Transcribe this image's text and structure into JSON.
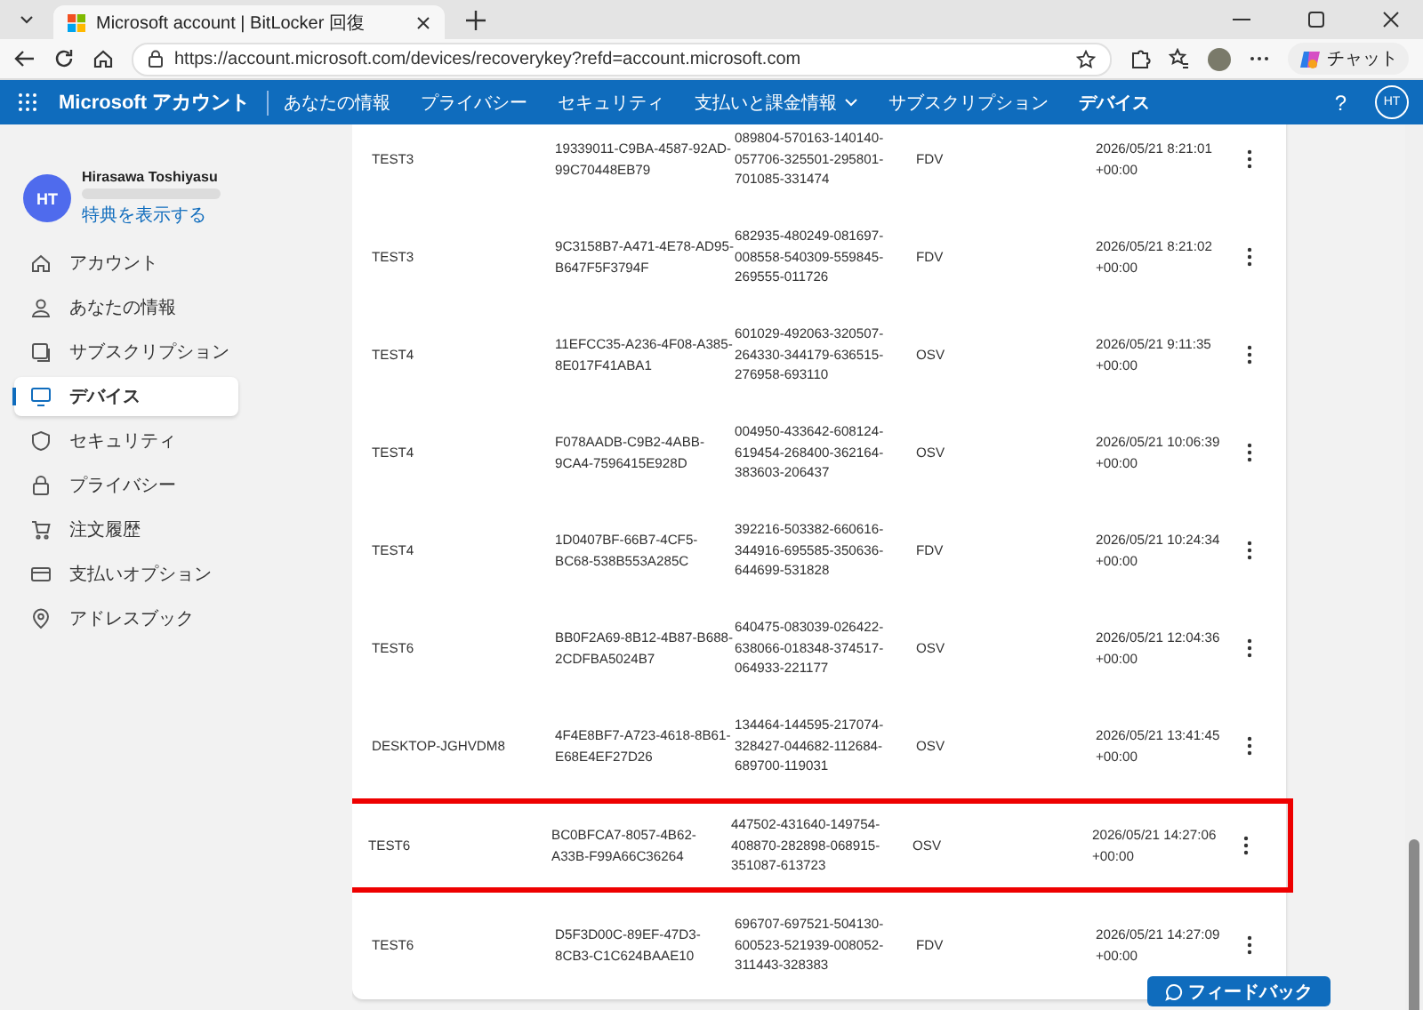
{
  "browser": {
    "tab_title": "Microsoft account | BitLocker 回復",
    "url": "https://account.microsoft.com/devices/recoverykey?refd=account.microsoft.com",
    "chat_label": "チャット"
  },
  "nav": {
    "brand": "Microsoft アカウント",
    "items": [
      {
        "label": "あなたの情報",
        "selected": false,
        "dropdown": false
      },
      {
        "label": "プライバシー",
        "selected": false,
        "dropdown": false
      },
      {
        "label": "セキュリティ",
        "selected": false,
        "dropdown": false
      },
      {
        "label": "支払いと課金情報",
        "selected": false,
        "dropdown": true
      },
      {
        "label": "サブスクリプション",
        "selected": false,
        "dropdown": false
      },
      {
        "label": "デバイス",
        "selected": true,
        "dropdown": false
      }
    ],
    "help": "?",
    "avatar": "HT"
  },
  "profile": {
    "initials": "HT",
    "name": "Hirasawa Toshiyasu",
    "link": "特典を表示する"
  },
  "sidebar": {
    "items": [
      {
        "label": "アカウント",
        "selected": false
      },
      {
        "label": "あなたの情報",
        "selected": false
      },
      {
        "label": "サブスクリプション",
        "selected": false
      },
      {
        "label": "デバイス",
        "selected": true
      },
      {
        "label": "セキュリティ",
        "selected": false
      },
      {
        "label": "プライバシー",
        "selected": false
      },
      {
        "label": "注文履歴",
        "selected": false
      },
      {
        "label": "支払いオプション",
        "selected": false
      },
      {
        "label": "アドレスブック",
        "selected": false
      }
    ]
  },
  "table": {
    "rows": [
      {
        "device": "TEST3",
        "key_id": "19339011-C9BA-4587-92AD-99C70448EB79",
        "recovery_key": "089804-570163-140140-057706-325501-295801-701085-331474",
        "drive": "FDV",
        "uploaded": "2026/05/21 8:21:01 +00:00",
        "highlighted": false
      },
      {
        "device": "TEST3",
        "key_id": "9C3158B7-A471-4E78-AD95-B647F5F3794F",
        "recovery_key": "682935-480249-081697-008558-540309-559845-269555-011726",
        "drive": "FDV",
        "uploaded": "2026/05/21 8:21:02 +00:00",
        "highlighted": false
      },
      {
        "device": "TEST4",
        "key_id": "11EFCC35-A236-4F08-A385-8E017F41ABA1",
        "recovery_key": "601029-492063-320507-264330-344179-636515-276958-693110",
        "drive": "OSV",
        "uploaded": "2026/05/21 9:11:35 +00:00",
        "highlighted": false
      },
      {
        "device": "TEST4",
        "key_id": "F078AADB-C9B2-4ABB-9CA4-7596415E928D",
        "recovery_key": "004950-433642-608124-619454-268400-362164-383603-206437",
        "drive": "OSV",
        "uploaded": "2026/05/21 10:06:39 +00:00",
        "highlighted": false
      },
      {
        "device": "TEST4",
        "key_id": "1D0407BF-66B7-4CF5-BC68-538B553A285C",
        "recovery_key": "392216-503382-660616-344916-695585-350636-644699-531828",
        "drive": "FDV",
        "uploaded": "2026/05/21 10:24:34 +00:00",
        "highlighted": false
      },
      {
        "device": "TEST6",
        "key_id": "BB0F2A69-8B12-4B87-B688-2CDFBA5024B7",
        "recovery_key": "640475-083039-026422-638066-018348-374517-064933-221177",
        "drive": "OSV",
        "uploaded": "2026/05/21 12:04:36 +00:00",
        "highlighted": false
      },
      {
        "device": "DESKTOP-JGHVDM8",
        "key_id": "4F4E8BF7-A723-4618-8B61-E68E4EF27D26",
        "recovery_key": "134464-144595-217074-328427-044682-112684-689700-119031",
        "drive": "OSV",
        "uploaded": "2026/05/21 13:41:45 +00:00",
        "highlighted": false
      },
      {
        "device": "TEST6",
        "key_id": "BC0BFCA7-8057-4B62-A33B-F99A66C36264",
        "recovery_key": "447502-431640-149754-408870-282898-068915-351087-613723",
        "drive": "OSV",
        "uploaded": "2026/05/21 14:27:06 +00:00",
        "highlighted": true
      },
      {
        "device": "TEST6",
        "key_id": "D5F3D00C-89EF-47D3-8CB3-C1C624BAAE10",
        "recovery_key": "696707-697521-504130-600523-521939-008052-311443-328383",
        "drive": "FDV",
        "uploaded": "2026/05/21 14:27:09 +00:00",
        "highlighted": false
      }
    ]
  },
  "feedback": "フィードバック"
}
